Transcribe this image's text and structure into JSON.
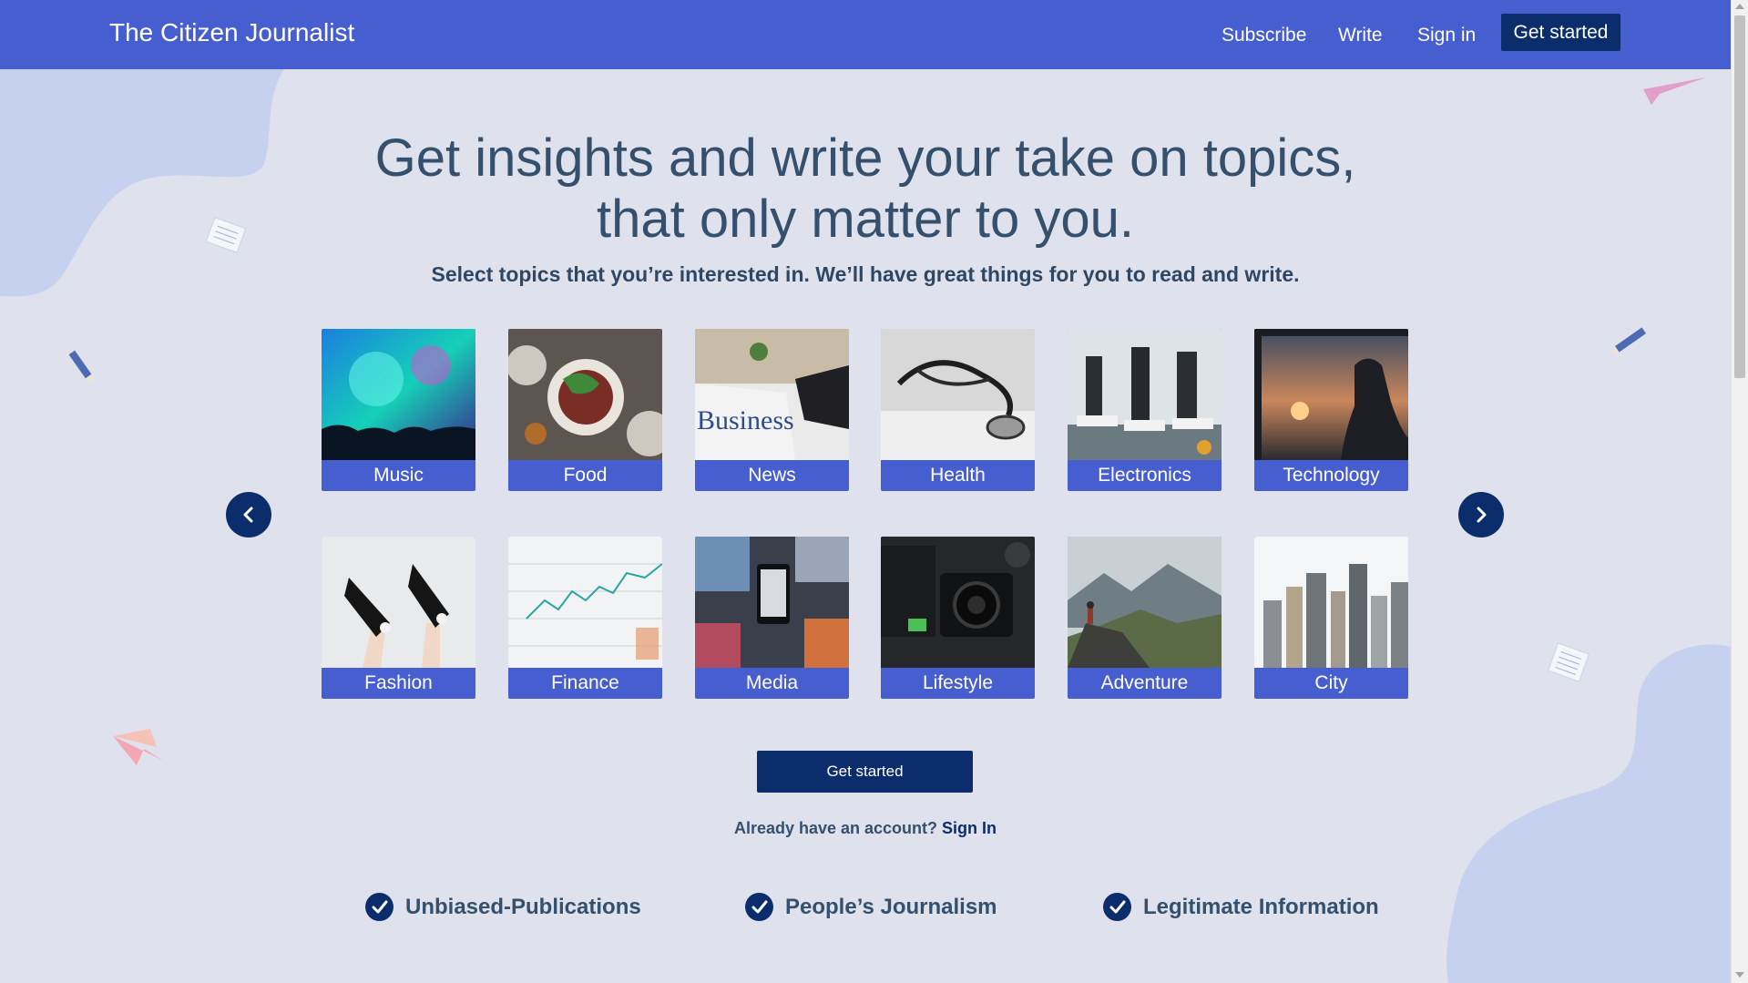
{
  "navbar": {
    "brand": "The Citizen Journalist",
    "links": [
      "Subscribe",
      "Write",
      "Sign in"
    ],
    "cta": "Get started"
  },
  "hero": {
    "headline_line1": "Get insights and write your take on topics,",
    "headline_line2": "that only matter to you.",
    "subheadline": "Select topics that you’re interested in. We’ll have great things for you to read and write."
  },
  "topics": [
    {
      "label": "Music",
      "icon": "concert-image"
    },
    {
      "label": "Food",
      "icon": "food-image"
    },
    {
      "label": "News",
      "icon": "newspaper-image"
    },
    {
      "label": "Health",
      "icon": "stethoscope-image"
    },
    {
      "label": "Electronics",
      "icon": "microscope-image"
    },
    {
      "label": "Technology",
      "icon": "window-view-image"
    },
    {
      "label": "Fashion",
      "icon": "sneakers-image"
    },
    {
      "label": "Finance",
      "icon": "stock-chart-image"
    },
    {
      "label": "Media",
      "icon": "smartphone-image"
    },
    {
      "label": "Lifestyle",
      "icon": "camera-image"
    },
    {
      "label": "Adventure",
      "icon": "mountain-image"
    },
    {
      "label": "City",
      "icon": "skyline-image"
    }
  ],
  "carousel": {
    "prev_icon": "chevron-left-icon",
    "next_icon": "chevron-right-icon"
  },
  "cta": {
    "button": "Get started",
    "signin_prompt": "Already have an account?",
    "signin_link": "Sign In"
  },
  "features": [
    "Unbiased-Publications",
    "People’s Journalism",
    "Legitimate Information"
  ],
  "colors": {
    "navbar": "#465ecf",
    "primary_dark": "#0c2d6b",
    "background": "#dfe2ed",
    "heading_text": "#34506d",
    "blob": "#c5d1ef"
  }
}
